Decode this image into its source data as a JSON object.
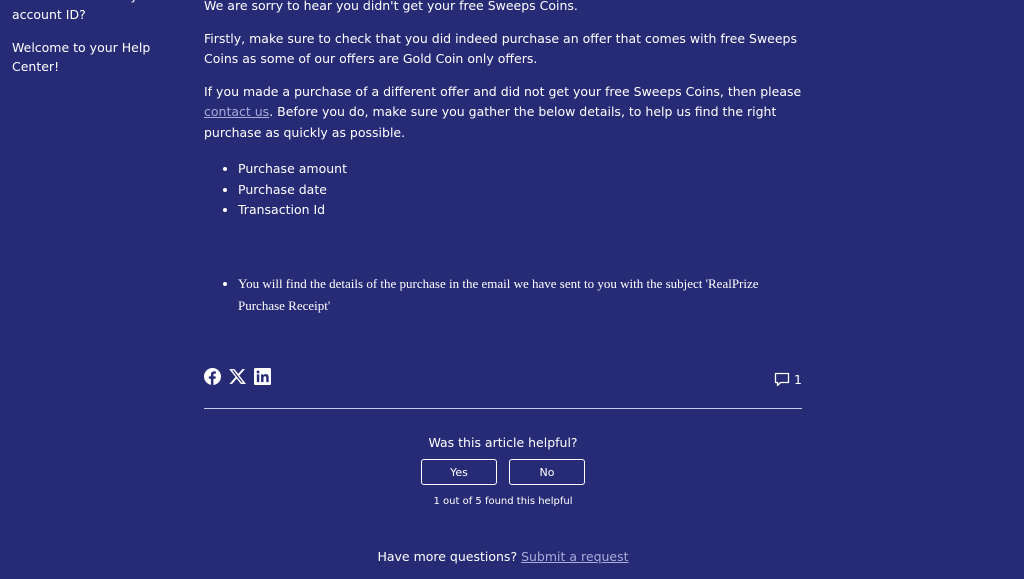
{
  "sidebar": {
    "items": [
      {
        "label": "Where can I find my account ID?"
      },
      {
        "label": "Welcome to your Help Center!"
      }
    ]
  },
  "article": {
    "intro": "We are sorry to hear you didn't get your free Sweeps Coins.",
    "paragraph1": "Firstly, make sure to check that you did indeed purchase an offer that comes with free Sweeps Coins as some of our offers are Gold Coin only offers.",
    "paragraph2_before_link": "If you made a purchase of a different offer and did not get your free Sweeps Coins, then please ",
    "paragraph2_link": "contact us",
    "paragraph2_after_link": ". Before you do, make sure you gather the below details, to help us find the right purchase as quickly as possible.",
    "details": [
      "Purchase amount",
      "Purchase date",
      "Transaction Id"
    ],
    "note": "You will find the details of the purchase in the email we have sent to you with the subject 'RealPrize Purchase Receipt'"
  },
  "share": {
    "icons": [
      "facebook-icon",
      "x-icon",
      "linkedin-icon"
    ],
    "comment_count": "1"
  },
  "vote": {
    "question": "Was this article helpful?",
    "yes_label": "Yes",
    "no_label": "No",
    "count_text": "1 out of 5 found this helpful"
  },
  "footer": {
    "question": "Have more questions?",
    "link": "Submit a request"
  },
  "colors": {
    "background": "#272a75",
    "text": "#ffffff",
    "link": "#a7acd9"
  }
}
